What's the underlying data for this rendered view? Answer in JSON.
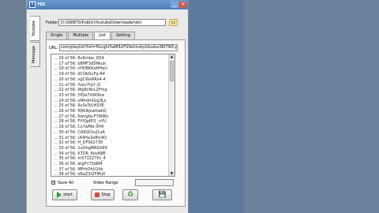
{
  "window": {
    "title": "YDL",
    "app_icon": "Y"
  },
  "side_tabs": [
    "Youtube",
    "Message"
  ],
  "folder": {
    "label": "Folder",
    "value": "D:\\SWBTS\\Public\\YoutubeDownloader\\bin"
  },
  "tabs": [
    "Single",
    "Multiple",
    "List",
    "Setting"
  ],
  "url": {
    "label": "URL:",
    "value": "com/playlist?list=PLnghr5aM3d7S3ehhxbyUksdsx3Kl7WCymC"
  },
  "list_items": [
    "... 16 of 56: 8uKmbe_QS4",
    "... 17 of 56: b8MF3d5Nkuk",
    "... 18 of 56: cHDBKKaHHeU",
    "... 19 of 56: dCOb5uFq-R4",
    "... 20 of 56: vgCWxRRs4-4",
    "... 21 of 56: Yuxv7lq7-2I",
    "... 22 of 56: Wg8cNcL2Frng",
    "... 23 of 56: YfQe7Vi9Okw",
    "... 24 of 56: xMhdm0zg3Ls",
    "... 25 of 56: 9uSsTyLH33E",
    "... 26 of 56: fQfkNjswhwkQ",
    "... 27 of 56: Kwvgfq-F7WWs",
    "... 28 of 56: FYIQpEP1_nYU",
    "... 29 of 56: Cs7wMd-3H4",
    "... 30 of 56: CA9QCkvJ1uA",
    "... 31 of 56: Ut4Ha2e8ln4Q",
    "... 32 of 56: H_DFS62730",
    "... 33 of 56: 1uDhgMRGhE0",
    "... 34 of 56: K7DR_6ovN8E",
    "... 35 of 56: m5712Z7fU_4",
    "... 36 of 56: atgFnT3d8M",
    "... 37 of 56: MPrhOhU2hk",
    "... 38 of 56: oRaZ3t2FMu0"
  ],
  "save_all": {
    "label": "Save All",
    "checked_mark": "✓"
  },
  "video_range": {
    "label": "Video Range"
  },
  "buttons": {
    "start": "start",
    "stop": "Stop",
    "recycle_icon": "♻",
    "save_icon": "💾"
  },
  "scroll": {
    "up": "▲",
    "down": "▼"
  },
  "window_buttons": {
    "minimize": "_",
    "close": "✕"
  }
}
